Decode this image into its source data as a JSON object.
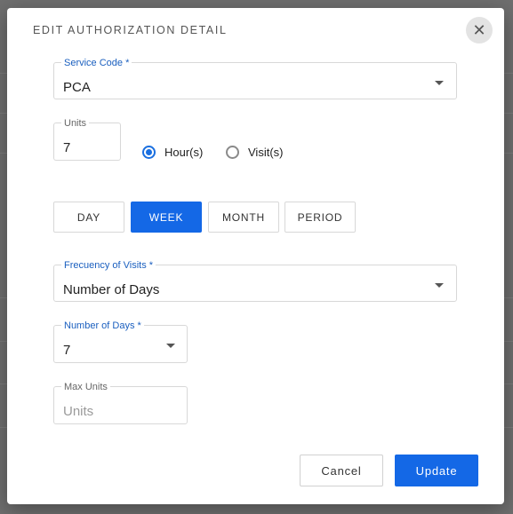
{
  "dialog": {
    "title": "EDIT AUTHORIZATION DETAIL",
    "close_icon": "close-icon"
  },
  "service_code": {
    "label": "Service Code *",
    "value": "PCA"
  },
  "units": {
    "label": "Units",
    "value": "7"
  },
  "unit_type": {
    "options": [
      {
        "label": "Hour(s)",
        "checked": true
      },
      {
        "label": "Visit(s)",
        "checked": false
      }
    ]
  },
  "period_tabs": [
    {
      "label": "DAY",
      "active": false
    },
    {
      "label": "WEEK",
      "active": true
    },
    {
      "label": "MONTH",
      "active": false
    },
    {
      "label": "PERIOD",
      "active": false
    }
  ],
  "frequency": {
    "label": "Frecuency of Visits *",
    "value": "Number of Days"
  },
  "number_of_days": {
    "label": "Number of Days *",
    "value": "7"
  },
  "max_units": {
    "label": "Max Units",
    "placeholder": "Units"
  },
  "actions": {
    "cancel": "Cancel",
    "update": "Update"
  },
  "colors": {
    "accent": "#1468e6",
    "label_blue": "#1a5fbf",
    "overlay": "#6f6f6f"
  }
}
